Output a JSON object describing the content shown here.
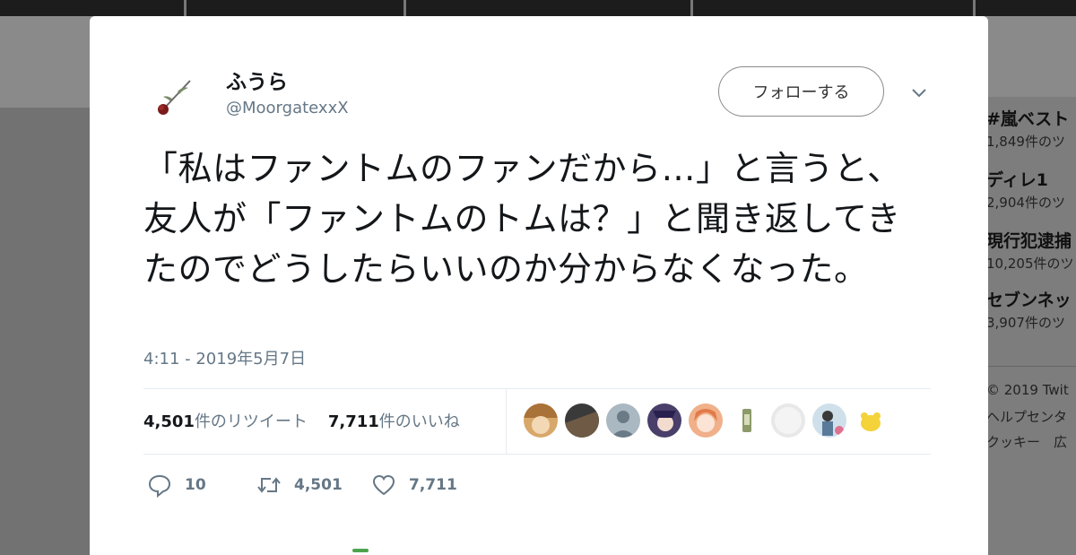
{
  "tweet": {
    "author_name": "ふうら",
    "handle": "@MoorgatexxX",
    "follow_label": "フォローする",
    "text": "「私はファントムのファンだから…」と言うと、友人が「ファントムのトムは？」と聞き返してきたのでどうしたらいいのか分からなくなった。",
    "timestamp": "4:11 - 2019年5月7日",
    "retweet_count": "4,501",
    "retweet_suffix": "件のリツイート",
    "like_count": "7,711",
    "like_suffix": "件のいいね",
    "actions": {
      "reply": "10",
      "retweet": "4,501",
      "like": "7,711"
    }
  },
  "icons": {
    "avatar": "rose-avatar",
    "caret": "chevron-down-icon",
    "reply": "reply-icon",
    "retweet": "retweet-icon",
    "like": "heart-icon"
  },
  "sidebar": {
    "trends": [
      {
        "title": "#嵐ベスト",
        "count": "1,849件のツ"
      },
      {
        "title": "ディレ1",
        "count": "2,904件のツ"
      },
      {
        "title": "現行犯逮捕",
        "count": "10,205件のツ"
      },
      {
        "title": "セブンネッ",
        "count": "3,907件のツ"
      }
    ],
    "footer": [
      "© 2019 Twit",
      "ヘルプセンタ",
      "クッキー　広"
    ]
  },
  "colors": {
    "text_primary": "#14171a",
    "text_secondary": "#657786",
    "divider": "#e6ecf0",
    "overlay": "#727272"
  }
}
